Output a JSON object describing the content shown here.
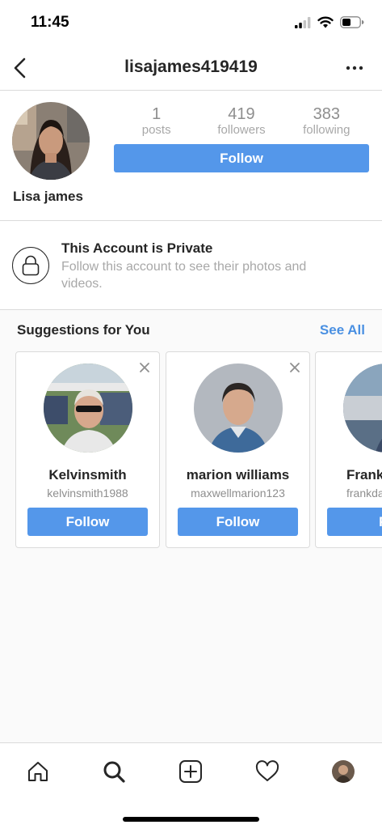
{
  "status_bar": {
    "time": "11:45"
  },
  "header": {
    "username": "lisajames419419"
  },
  "profile": {
    "posts_count": "1",
    "posts_label": "posts",
    "followers_count": "419",
    "followers_label": "followers",
    "following_count": "383",
    "following_label": "following",
    "follow_label": "Follow",
    "display_name": "Lisa james"
  },
  "private_notice": {
    "title": "This Account is Private",
    "description": "Follow this account to see their photos and videos."
  },
  "suggestions": {
    "title": "Suggestions for You",
    "see_all": "See All",
    "cards": [
      {
        "name": "Kelvinsmith",
        "username": "kelvinsmith1988",
        "follow_label": "Follow"
      },
      {
        "name": "marion williams",
        "username": "maxwellmarion123",
        "follow_label": "Follow"
      },
      {
        "name": "Frank",
        "username": "frankda",
        "follow_label": "Fo"
      }
    ]
  },
  "tab_bar": {
    "tabs": [
      "home-icon",
      "search-icon",
      "new-post-icon",
      "activity-heart-icon",
      "profile-avatar"
    ]
  },
  "colors": {
    "accent_blue": "#5497ea",
    "link_blue": "#4a90e2",
    "text_primary": "#262626",
    "text_secondary": "#8e8e8e",
    "divider": "#dbdbdb"
  }
}
